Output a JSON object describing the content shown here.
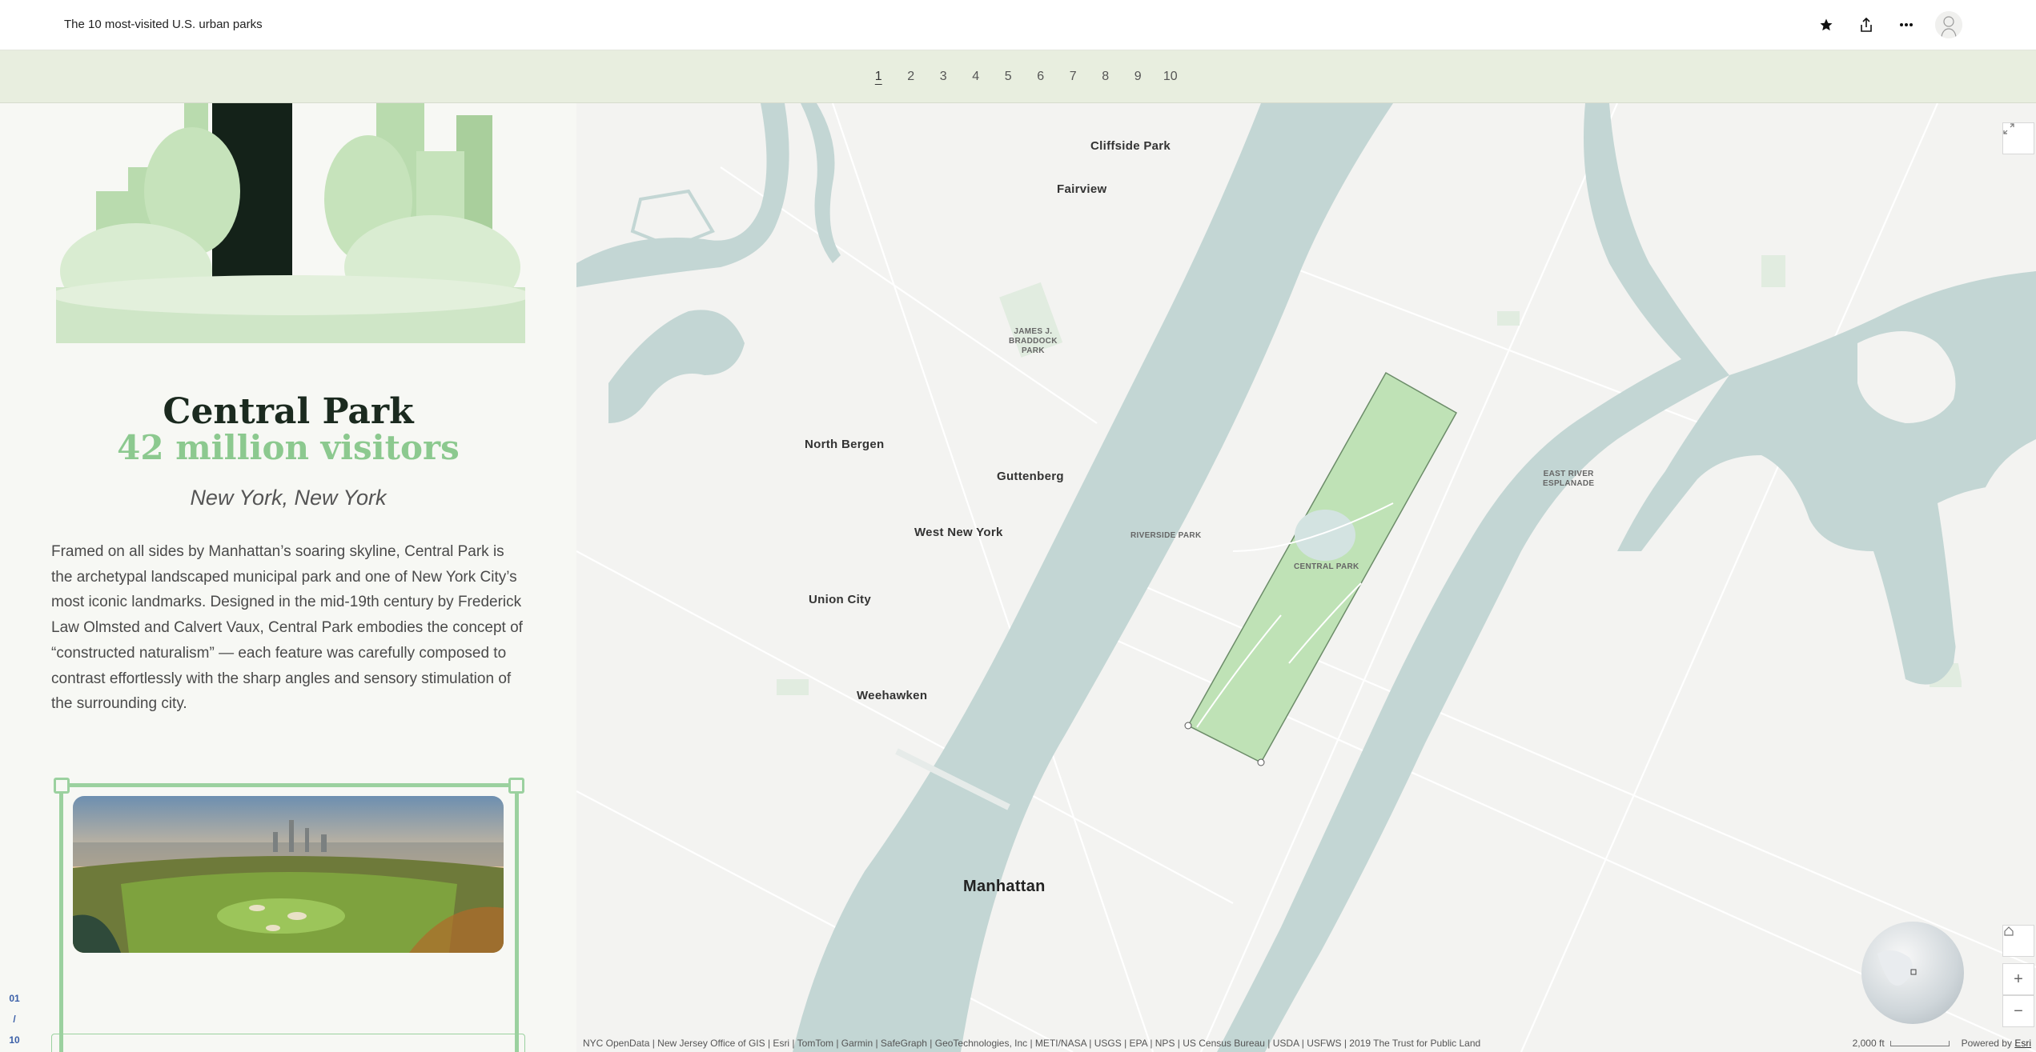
{
  "header": {
    "story_title": "The 10 most-visited U.S. urban parks",
    "icons": [
      "favorite-star-icon",
      "share-icon",
      "more-options-icon",
      "author-avatar"
    ]
  },
  "nav": {
    "items": [
      "1",
      "2",
      "3",
      "4",
      "5",
      "6",
      "7",
      "8",
      "9",
      "10"
    ],
    "active_index": 0
  },
  "park": {
    "name": "Central Park",
    "visitors": "42 million visitors",
    "location": "New York, New York",
    "description": "Framed on all sides by Manhattan’s soaring skyline, Central Park is the archetypal landscaped municipal park and one of New York City’s most iconic landmarks. Designed in the mid-19th century by Frederick Law Olmsted and Calvert Vaux, Central Park embodies the concept of “constructed naturalism” — each feature was carefully composed to contrast effortlessly with the sharp angles and sensory stimulation of the surrounding city."
  },
  "pager": {
    "current": "01",
    "separator": "/",
    "total": "10"
  },
  "map": {
    "labels": {
      "cliffside_park": "Cliffside Park",
      "fairview": "Fairview",
      "braddock_1": "JAMES J.",
      "braddock_2": "BRADDOCK",
      "braddock_3": "PARK",
      "north_bergen": "North Bergen",
      "guttenberg": "Guttenberg",
      "west_new_york": "West New York",
      "union_city": "Union City",
      "weehawken": "Weehawken",
      "riverside_park": "RIVERSIDE PARK",
      "central_park": "CENTRAL PARK",
      "east_river_1": "EAST RIVER",
      "east_river_2": "ESPLANADE",
      "manhattan": "Manhattan"
    },
    "attribution": "NYC OpenData | New Jersey Office of GIS | Esri | TomTom | Garmin | SafeGraph | GeoTechnologies, Inc | METI/NASA | USGS | EPA | NPS | US Census Bureau | USDA | USFWS | 2019 The Trust for Public Land",
    "scale_label": "2,000 ft",
    "powered_by": "Powered by",
    "powered_by_brand": "Esri",
    "colors": {
      "water": "#c3d6d4",
      "land": "#f3f3f1",
      "park": "#cfe6c7",
      "highlight": "#bfe2b6"
    }
  }
}
